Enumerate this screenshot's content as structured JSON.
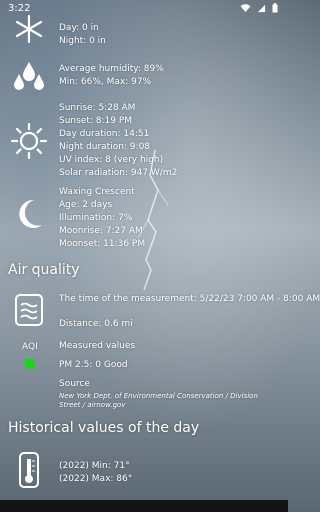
{
  "statusbar": {
    "time": "3:22"
  },
  "precipitation": {
    "day": "Day: 0 in",
    "night": "Night: 0 in"
  },
  "humidity": {
    "average": "Average humidity: 89%",
    "minmax": "Min: 66%, Max: 97%"
  },
  "sun": {
    "sunrise": "Sunrise: 5:28 AM",
    "sunset": "Sunset: 8:19 PM",
    "day_duration": "Day duration: 14:51",
    "night_duration": "Night duration: 9:08",
    "uv": "UV index: 8 (very high)",
    "radiation": "Solar radiation: 947 W/m2"
  },
  "moon": {
    "phase": "Waxing Crescent",
    "age": "Age: 2 days",
    "illumination": "Illumination: 7%",
    "moonrise": "Moonrise: 7:27 AM",
    "moonset": "Moonset: 11:36 PM"
  },
  "air_quality": {
    "heading": "Air quality",
    "measurement_time": "The time of the measurement: 5/22/23 7:00 AM - 8:00 AM",
    "distance": "Distance: 0.6 mi",
    "aqi_label": "AQI",
    "measured_values": "Measured values",
    "pm25": "PM 2.5: 0  Good",
    "source_label": "Source",
    "source_text": "New York Dept. of Environmental Conservation / Division Street / airnow.gov",
    "status_color": "#1fd21f"
  },
  "historical": {
    "heading": "Historical values of the day",
    "min": "(2022) Min: 71°",
    "max": "(2022) Max: 86°"
  }
}
